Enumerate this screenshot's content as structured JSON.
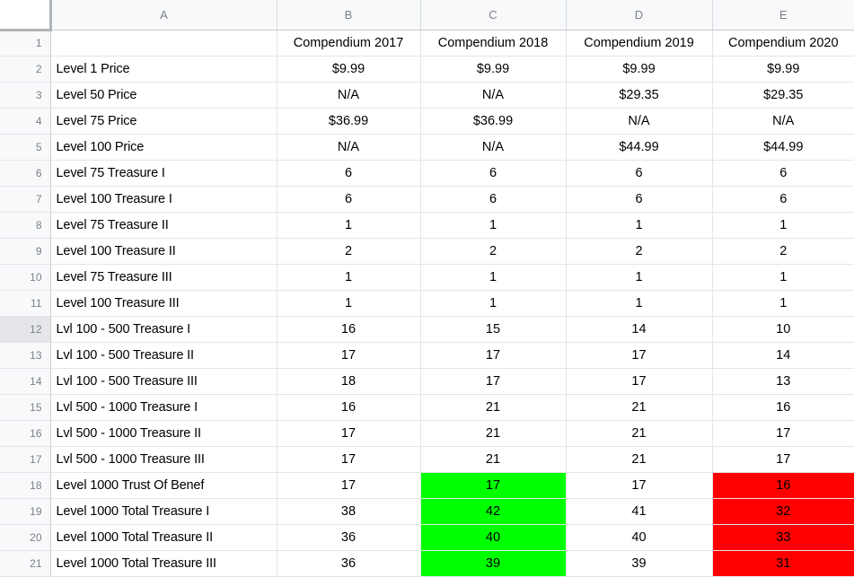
{
  "spreadsheet": {
    "corner_label": "",
    "column_headers": [
      "A",
      "B",
      "C",
      "D",
      "E"
    ],
    "row_numbers": [
      "1",
      "2",
      "3",
      "4",
      "5",
      "6",
      "7",
      "8",
      "9",
      "10",
      "11",
      "12",
      "13",
      "14",
      "15",
      "16",
      "17",
      "18",
      "19",
      "20",
      "21"
    ],
    "selected_row": "12",
    "colors": {
      "highlight_green": "#00ff00",
      "highlight_red": "#ff0000",
      "header_background": "#f8f9fa",
      "header_text": "#7b7f84",
      "gridline": "#e3e5e8",
      "cell_text": "#000000"
    },
    "rows": [
      {
        "number": "1",
        "cells": [
          {
            "value": "",
            "align": "left",
            "fill": "none"
          },
          {
            "value": "Compendium 2017",
            "align": "center",
            "fill": "none"
          },
          {
            "value": "Compendium 2018",
            "align": "center",
            "fill": "none"
          },
          {
            "value": "Compendium 2019",
            "align": "center",
            "fill": "none"
          },
          {
            "value": "Compendium 2020",
            "align": "center",
            "fill": "none"
          }
        ]
      },
      {
        "number": "2",
        "cells": [
          {
            "value": "Level 1 Price",
            "align": "left",
            "fill": "none"
          },
          {
            "value": "$9.99",
            "align": "center",
            "fill": "none"
          },
          {
            "value": "$9.99",
            "align": "center",
            "fill": "none"
          },
          {
            "value": "$9.99",
            "align": "center",
            "fill": "none"
          },
          {
            "value": "$9.99",
            "align": "center",
            "fill": "none"
          }
        ]
      },
      {
        "number": "3",
        "cells": [
          {
            "value": "Level 50 Price",
            "align": "left",
            "fill": "none"
          },
          {
            "value": "N/A",
            "align": "center",
            "fill": "none"
          },
          {
            "value": "N/A",
            "align": "center",
            "fill": "none"
          },
          {
            "value": "$29.35",
            "align": "center",
            "fill": "none"
          },
          {
            "value": "$29.35",
            "align": "center",
            "fill": "none"
          }
        ]
      },
      {
        "number": "4",
        "cells": [
          {
            "value": "Level 75 Price",
            "align": "left",
            "fill": "none"
          },
          {
            "value": "$36.99",
            "align": "center",
            "fill": "none"
          },
          {
            "value": "$36.99",
            "align": "center",
            "fill": "none"
          },
          {
            "value": "N/A",
            "align": "center",
            "fill": "none"
          },
          {
            "value": "N/A",
            "align": "center",
            "fill": "none"
          }
        ]
      },
      {
        "number": "5",
        "cells": [
          {
            "value": "Level 100 Price",
            "align": "left",
            "fill": "none"
          },
          {
            "value": "N/A",
            "align": "center",
            "fill": "none"
          },
          {
            "value": "N/A",
            "align": "center",
            "fill": "none"
          },
          {
            "value": "$44.99",
            "align": "center",
            "fill": "none"
          },
          {
            "value": "$44.99",
            "align": "center",
            "fill": "none"
          }
        ]
      },
      {
        "number": "6",
        "cells": [
          {
            "value": "Level 75 Treasure I",
            "align": "left",
            "fill": "none"
          },
          {
            "value": "6",
            "align": "center",
            "fill": "none"
          },
          {
            "value": "6",
            "align": "center",
            "fill": "none"
          },
          {
            "value": "6",
            "align": "center",
            "fill": "none"
          },
          {
            "value": "6",
            "align": "center",
            "fill": "none"
          }
        ]
      },
      {
        "number": "7",
        "cells": [
          {
            "value": "Level 100 Treasure I",
            "align": "left",
            "fill": "none"
          },
          {
            "value": "6",
            "align": "center",
            "fill": "none"
          },
          {
            "value": "6",
            "align": "center",
            "fill": "none"
          },
          {
            "value": "6",
            "align": "center",
            "fill": "none"
          },
          {
            "value": "6",
            "align": "center",
            "fill": "none"
          }
        ]
      },
      {
        "number": "8",
        "cells": [
          {
            "value": "Level 75 Treasure II",
            "align": "left",
            "fill": "none"
          },
          {
            "value": "1",
            "align": "center",
            "fill": "none"
          },
          {
            "value": "1",
            "align": "center",
            "fill": "none"
          },
          {
            "value": "1",
            "align": "center",
            "fill": "none"
          },
          {
            "value": "1",
            "align": "center",
            "fill": "none"
          }
        ]
      },
      {
        "number": "9",
        "cells": [
          {
            "value": "Level 100 Treasure II",
            "align": "left",
            "fill": "none"
          },
          {
            "value": "2",
            "align": "center",
            "fill": "none"
          },
          {
            "value": "2",
            "align": "center",
            "fill": "none"
          },
          {
            "value": "2",
            "align": "center",
            "fill": "none"
          },
          {
            "value": "2",
            "align": "center",
            "fill": "none"
          }
        ]
      },
      {
        "number": "10",
        "cells": [
          {
            "value": "Level 75 Treasure III",
            "align": "left",
            "fill": "none"
          },
          {
            "value": "1",
            "align": "center",
            "fill": "none"
          },
          {
            "value": "1",
            "align": "center",
            "fill": "none"
          },
          {
            "value": "1",
            "align": "center",
            "fill": "none"
          },
          {
            "value": "1",
            "align": "center",
            "fill": "none"
          }
        ]
      },
      {
        "number": "11",
        "cells": [
          {
            "value": "Level 100 Treasure III",
            "align": "left",
            "fill": "none"
          },
          {
            "value": "1",
            "align": "center",
            "fill": "none"
          },
          {
            "value": "1",
            "align": "center",
            "fill": "none"
          },
          {
            "value": "1",
            "align": "center",
            "fill": "none"
          },
          {
            "value": "1",
            "align": "center",
            "fill": "none"
          }
        ]
      },
      {
        "number": "12",
        "cells": [
          {
            "value": "Lvl 100 - 500 Treasure I",
            "align": "left",
            "fill": "none"
          },
          {
            "value": "16",
            "align": "center",
            "fill": "none"
          },
          {
            "value": "15",
            "align": "center",
            "fill": "none"
          },
          {
            "value": "14",
            "align": "center",
            "fill": "none"
          },
          {
            "value": "10",
            "align": "center",
            "fill": "none"
          }
        ]
      },
      {
        "number": "13",
        "cells": [
          {
            "value": "Lvl 100 - 500 Treasure II",
            "align": "left",
            "fill": "none"
          },
          {
            "value": "17",
            "align": "center",
            "fill": "none"
          },
          {
            "value": "17",
            "align": "center",
            "fill": "none"
          },
          {
            "value": "17",
            "align": "center",
            "fill": "none"
          },
          {
            "value": "14",
            "align": "center",
            "fill": "none"
          }
        ]
      },
      {
        "number": "14",
        "cells": [
          {
            "value": "Lvl 100 - 500 Treasure III",
            "align": "left",
            "fill": "none"
          },
          {
            "value": "18",
            "align": "center",
            "fill": "none"
          },
          {
            "value": "17",
            "align": "center",
            "fill": "none"
          },
          {
            "value": "17",
            "align": "center",
            "fill": "none"
          },
          {
            "value": "13",
            "align": "center",
            "fill": "none"
          }
        ]
      },
      {
        "number": "15",
        "cells": [
          {
            "value": "Lvl 500 - 1000 Treasure I",
            "align": "left",
            "fill": "none"
          },
          {
            "value": "16",
            "align": "center",
            "fill": "none"
          },
          {
            "value": "21",
            "align": "center",
            "fill": "none"
          },
          {
            "value": "21",
            "align": "center",
            "fill": "none"
          },
          {
            "value": "16",
            "align": "center",
            "fill": "none"
          }
        ]
      },
      {
        "number": "16",
        "cells": [
          {
            "value": "Lvl 500 - 1000 Treasure II",
            "align": "left",
            "fill": "none"
          },
          {
            "value": "17",
            "align": "center",
            "fill": "none"
          },
          {
            "value": "21",
            "align": "center",
            "fill": "none"
          },
          {
            "value": "21",
            "align": "center",
            "fill": "none"
          },
          {
            "value": "17",
            "align": "center",
            "fill": "none"
          }
        ]
      },
      {
        "number": "17",
        "cells": [
          {
            "value": "Lvl 500 - 1000 Treasure III",
            "align": "left",
            "fill": "none"
          },
          {
            "value": "17",
            "align": "center",
            "fill": "none"
          },
          {
            "value": "21",
            "align": "center",
            "fill": "none"
          },
          {
            "value": "21",
            "align": "center",
            "fill": "none"
          },
          {
            "value": "17",
            "align": "center",
            "fill": "none"
          }
        ]
      },
      {
        "number": "18",
        "cells": [
          {
            "value": "Level 1000 Trust Of Benef",
            "align": "left",
            "fill": "none"
          },
          {
            "value": "17",
            "align": "center",
            "fill": "none"
          },
          {
            "value": "17",
            "align": "center",
            "fill": "green"
          },
          {
            "value": "17",
            "align": "center",
            "fill": "none"
          },
          {
            "value": "16",
            "align": "center",
            "fill": "red"
          }
        ]
      },
      {
        "number": "19",
        "cells": [
          {
            "value": "Level 1000 Total Treasure I",
            "align": "left",
            "fill": "none"
          },
          {
            "value": "38",
            "align": "center",
            "fill": "none"
          },
          {
            "value": "42",
            "align": "center",
            "fill": "green"
          },
          {
            "value": "41",
            "align": "center",
            "fill": "none"
          },
          {
            "value": "32",
            "align": "center",
            "fill": "red"
          }
        ]
      },
      {
        "number": "20",
        "cells": [
          {
            "value": "Level 1000 Total Treasure II",
            "align": "left",
            "fill": "none"
          },
          {
            "value": "36",
            "align": "center",
            "fill": "none"
          },
          {
            "value": "40",
            "align": "center",
            "fill": "green"
          },
          {
            "value": "40",
            "align": "center",
            "fill": "none"
          },
          {
            "value": "33",
            "align": "center",
            "fill": "red"
          }
        ]
      },
      {
        "number": "21",
        "cells": [
          {
            "value": "Level 1000 Total Treasure III",
            "align": "left",
            "fill": "none"
          },
          {
            "value": "36",
            "align": "center",
            "fill": "none"
          },
          {
            "value": "39",
            "align": "center",
            "fill": "green"
          },
          {
            "value": "39",
            "align": "center",
            "fill": "none"
          },
          {
            "value": "31",
            "align": "center",
            "fill": "red"
          }
        ]
      }
    ]
  }
}
